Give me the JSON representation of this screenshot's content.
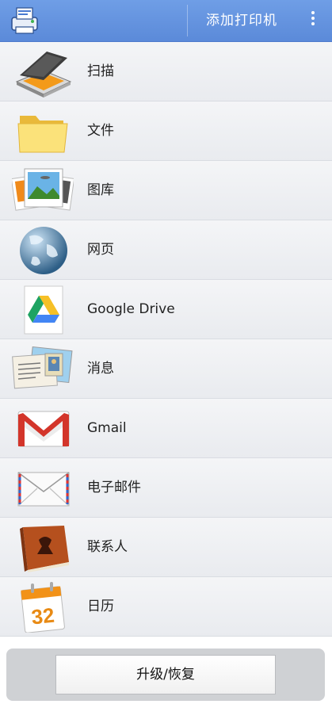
{
  "topbar": {
    "add_printer_label": "添加打印机"
  },
  "menu": [
    {
      "label": "扫描",
      "icon": "scanner-icon"
    },
    {
      "label": "文件",
      "icon": "folder-icon"
    },
    {
      "label": "图库",
      "icon": "photos-icon"
    },
    {
      "label": "网页",
      "icon": "globe-icon"
    },
    {
      "label": "Google Drive",
      "icon": "google-drive-icon"
    },
    {
      "label": "消息",
      "icon": "postcard-icon"
    },
    {
      "label": "Gmail",
      "icon": "gmail-icon"
    },
    {
      "label": "电子邮件",
      "icon": "envelope-icon"
    },
    {
      "label": "联系人",
      "icon": "contacts-book-icon"
    },
    {
      "label": "日历",
      "icon": "calendar-icon"
    }
  ],
  "calendar_icon_day": "32",
  "bottom": {
    "upgrade_label": "升级/恢复"
  }
}
